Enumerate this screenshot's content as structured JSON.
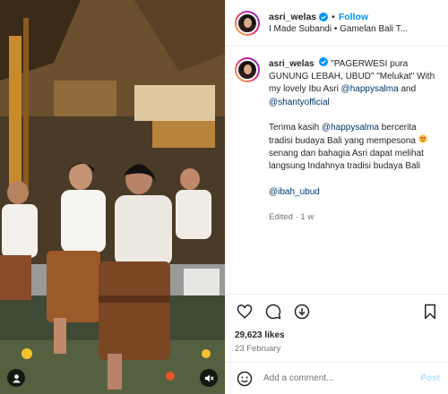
{
  "header": {
    "username": "asri_welas",
    "follow_label": "Follow",
    "audio": "I Made Subandi • Gamelan Bali T..."
  },
  "caption": {
    "username": "asri_welas",
    "text1": "\"PAGERWESI pura GUNUNG LEBAH, UBUD\" \"Melukat\" With my lovely Ibu Asri",
    "mention1": "@happysalma",
    "and": "and",
    "mention2": "@shantyofficial",
    "para2_a": "Terima kasih",
    "mention3": "@happysalma",
    "para2_b": "bercerita tradisi budaya Bali yang mempesona",
    "para2_c": "senang dan bahagia Asri dapat melihat langsung Indahnya tradisi budaya Bali",
    "mention4": "@ibah_ubud",
    "edited": "Edited",
    "edited_time": "1 w"
  },
  "stats": {
    "likes": "29,623 likes",
    "date": "23 February"
  },
  "comment": {
    "placeholder": "Add a comment...",
    "post_label": "Post"
  },
  "icons": {
    "like": "heart-icon",
    "comment": "comment-icon",
    "share": "share-icon",
    "save": "bookmark-icon",
    "emoji": "smiley-icon",
    "verified": "verified-badge-icon",
    "mute": "speaker-muted-icon",
    "tag": "user-tag-icon"
  },
  "colors": {
    "accent": "#0095f6",
    "link": "#00376b",
    "muted": "#737373"
  }
}
